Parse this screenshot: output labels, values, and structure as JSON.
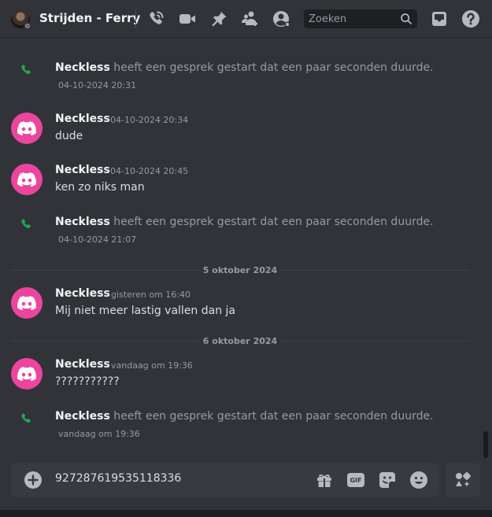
{
  "header": {
    "title": "Strijden - Ferry",
    "icons": [
      "phone-call-icon",
      "video-camera-icon",
      "pin-icon",
      "add-member-icon",
      "user-profile-icon",
      "inbox-icon",
      "help-icon"
    ],
    "search_placeholder": "Zoeken"
  },
  "messages": {
    "m1": {
      "author": "Neckless",
      "text": "heeft een gesprek gestart dat een paar seconden duurde.",
      "time": "04-10-2024 20:31"
    },
    "m2": {
      "author": "Neckless",
      "time": "04-10-2024 20:34",
      "content": "dude"
    },
    "m3": {
      "author": "Neckless",
      "time": "04-10-2024 20:45",
      "content": "ken zo niks man"
    },
    "m4": {
      "author": "Neckless",
      "text": "heeft een gesprek gestart dat een paar seconden duurde.",
      "time": "04-10-2024 21:07"
    },
    "d1": "5 oktober 2024",
    "m5": {
      "author": "Neckless",
      "time": "gisteren om 16:40",
      "content": "Mij niet meer lastig vallen dan ja"
    },
    "d2": "6 oktober 2024",
    "m6": {
      "author": "Neckless",
      "time": "vandaag om 19:36",
      "content": "???????????"
    },
    "m7": {
      "author": "Neckless",
      "text": "heeft een gesprek gestart dat een paar seconden duurde.",
      "time": "vandaag om 19:36"
    }
  },
  "composer": {
    "value": "927287619535118336",
    "icons": [
      "add-attachment-icon",
      "gift-icon",
      "gif-icon",
      "sticker-icon",
      "emoji-icon",
      "apps-icon"
    ],
    "gif_label": "GIF"
  },
  "colors": {
    "background": "#313338",
    "avatar": "#eb459e",
    "call_green": "#23a55a",
    "muted_text": "#949ba4"
  }
}
